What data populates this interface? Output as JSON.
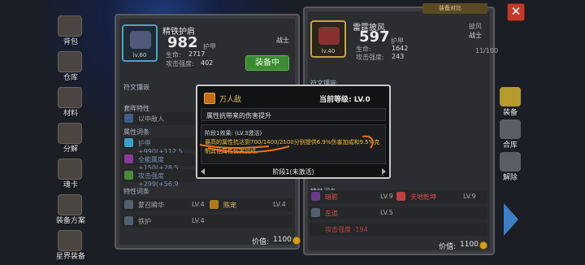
{
  "sidebar": {
    "items": [
      {
        "label": "背包",
        "icon": "bag-icon"
      },
      {
        "label": "仓库",
        "icon": "warehouse-icon"
      },
      {
        "label": "材料",
        "icon": "materials-icon"
      },
      {
        "label": "分解",
        "icon": "decompose-icon"
      },
      {
        "label": "魂卡",
        "icon": "soul-card-icon"
      },
      {
        "label": "装备方案",
        "icon": "equip-plan-icon"
      },
      {
        "label": "星界装备",
        "icon": "astral-equip-icon"
      }
    ]
  },
  "left_card": {
    "name": "精铁护肩",
    "level": "lv.60",
    "power": "982",
    "power_label": "护甲",
    "class": "战士",
    "hp_label": "生命:",
    "hp_value": "2717",
    "atk_label": "攻击强度:",
    "atk_value": "402",
    "equip_button": "装备中",
    "section_rune": "符文镶嵌",
    "section_special": "套阵特性",
    "special_row": "以中敌人",
    "section_affix": "属性词条",
    "affix_rows": [
      "护甲 +990(+112.5",
      "全能属度 +150(+28.5",
      "攻击强度 +299(+56.9"
    ],
    "section_set": "特性词条",
    "set_rows": [
      {
        "name": "蒙召瞬华",
        "lv": "LV.4",
        "name2": "陈宠",
        "lv2": "LV.4"
      },
      {
        "name": "铁护",
        "lv": "LV.4",
        "name2": "",
        "lv2": ""
      }
    ],
    "price_label": "价值:",
    "price_value": "1100"
  },
  "right_card": {
    "name": "雷霆披风",
    "level": "lv.40",
    "power": "597",
    "power_label": "护甲",
    "class_label": "披风",
    "class": "战士",
    "hp_label": "生命:",
    "hp_value": "1642",
    "atk_label": "攻击强度:",
    "atk_value": "243",
    "section_rune": "符文镶嵌",
    "count": "11/100",
    "section_set": "特性词条",
    "set_rows": [
      {
        "name": "暗影",
        "lv": "LV.9",
        "name2": "天地乾坤",
        "lv2": "LV.9"
      },
      {
        "name": "左追",
        "lv": "LV.5",
        "name2": "",
        "lv2": ""
      }
    ],
    "bottom_row": "攻击强度 -194",
    "price_label": "价值:",
    "price_value": "1100",
    "equip_tag": "装备对比"
  },
  "right_buttons": [
    {
      "label": "装备",
      "icon": "armor-icon",
      "color": "#b59a2c"
    },
    {
      "label": "合库",
      "icon": "store-icon",
      "color": "#5b5e64"
    },
    {
      "label": "解除",
      "icon": "unequip-icon",
      "color": "#5b5e64"
    }
  ],
  "popup": {
    "title": "万人敌",
    "level_label": "当前等级:",
    "level_value": "LV.0",
    "desc": "属性抗带来的伤害提升",
    "stage_title": "阶段1效果: (LV.3激活)",
    "stage_text": "最高的属性抗达到700/1400/2100分别提供6.9%伤害加成和9.5%克制其他属性伤害加成。",
    "nav_label": "阶段1(未激活)"
  },
  "colors": {
    "accent_orange": "#e8741a",
    "equip_green": "#3c8a34",
    "item_frame_blue": "#4da3c4",
    "text_gold": "#f0c030",
    "close_red": "#c23a2a"
  }
}
